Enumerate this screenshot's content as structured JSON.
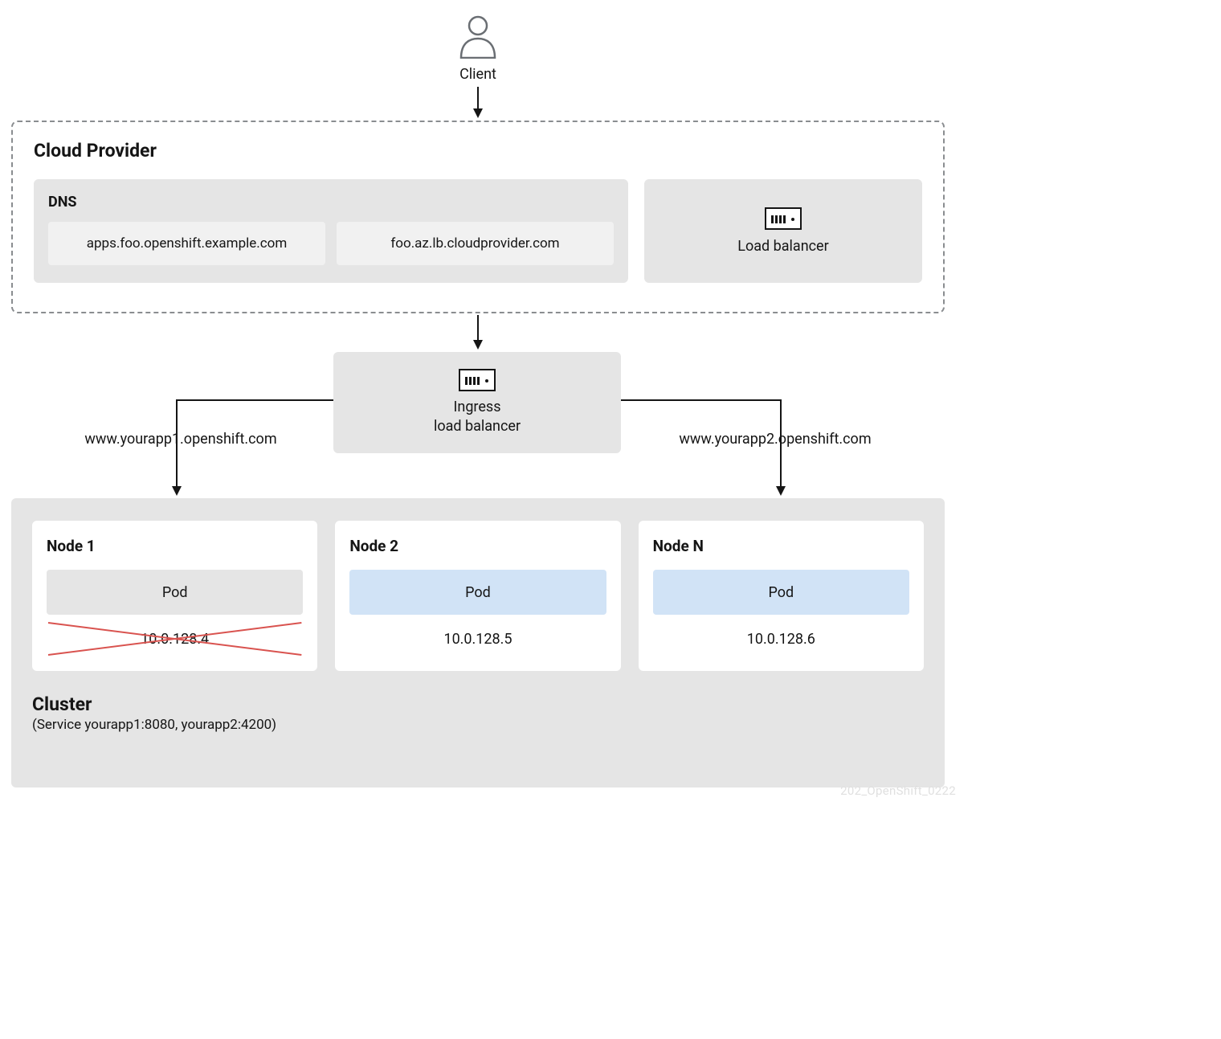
{
  "client": {
    "label": "Client"
  },
  "cloud_provider": {
    "title": "Cloud Provider",
    "dns": {
      "title": "DNS",
      "entries": [
        "apps.foo.openshift.example.com",
        "foo.az.lb.cloudprovider.com"
      ]
    },
    "load_balancer": {
      "label": "Load balancer"
    }
  },
  "ingress": {
    "label_line1": "Ingress",
    "label_line2": "load balancer"
  },
  "hosts": {
    "left": "www.yourapp1.openshift.com",
    "right": "www.yourapp2.openshift.com"
  },
  "cluster": {
    "title": "Cluster",
    "subtitle": "(Service yourapp1:8080, yourapp2:4200)",
    "nodes": [
      {
        "title": "Node 1",
        "pod_label": "Pod",
        "pod_style": "grey",
        "ip": "10.0.128.4",
        "crossed": true
      },
      {
        "title": "Node 2",
        "pod_label": "Pod",
        "pod_style": "blue",
        "ip": "10.0.128.5",
        "crossed": false
      },
      {
        "title": "Node N",
        "pod_label": "Pod",
        "pod_style": "blue",
        "ip": "10.0.128.6",
        "crossed": false
      }
    ]
  },
  "watermark": "202_OpenShift_0222"
}
